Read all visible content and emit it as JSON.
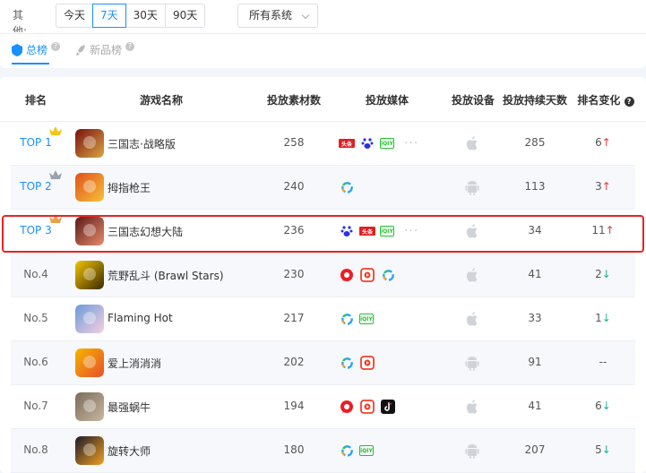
{
  "filters": {
    "other_label": "其他:",
    "date_buttons": [
      "今天",
      "7天",
      "30天",
      "90天"
    ],
    "active_date": "7天",
    "system_select": "所有系统"
  },
  "tabs": [
    {
      "label": "总榜",
      "active": true
    },
    {
      "label": "新品榜",
      "active": false
    }
  ],
  "table": {
    "headers": {
      "rank": "排名",
      "name": "游戏名称",
      "count": "投放素材数",
      "media": "投放媒体",
      "device": "投放设备",
      "days": "投放持续天数",
      "change": "排名变化"
    },
    "rows": [
      {
        "rank": "TOP 1",
        "name": "三国志·战略版",
        "count": "258",
        "media": [
          "toutiao-icon",
          "baidu-icon",
          "iqiyi-icon",
          "more-dots"
        ],
        "device": "apple-icon",
        "days": "285",
        "change": "6",
        "dir": "up"
      },
      {
        "rank": "TOP 2",
        "name": "拇指枪王",
        "count": "240",
        "media": [
          "ring-icon"
        ],
        "device": "android-icon",
        "days": "113",
        "change": "3",
        "dir": "up"
      },
      {
        "rank": "TOP 3",
        "name": "三国志幻想大陆",
        "count": "236",
        "media": [
          "baidu-icon",
          "toutiao-icon",
          "iqiyi-icon",
          "more-dots"
        ],
        "device": "apple-icon",
        "days": "34",
        "change": "11",
        "dir": "up"
      },
      {
        "rank": "No.4",
        "name": "荒野乱斗 (Brawl Stars)",
        "count": "230",
        "media": [
          "weibo-icon",
          "video-icon",
          "ring-icon"
        ],
        "device": "apple-icon",
        "days": "41",
        "change": "2",
        "dir": "down"
      },
      {
        "rank": "No.5",
        "name": "Flaming Hot",
        "count": "217",
        "media": [
          "ring-icon",
          "iqiyi-icon"
        ],
        "device": "apple-icon",
        "days": "33",
        "change": "1",
        "dir": "down"
      },
      {
        "rank": "No.6",
        "name": "爱上消消消",
        "count": "202",
        "media": [
          "ring-icon",
          "video-icon"
        ],
        "device": "android-icon",
        "days": "91",
        "change": "--",
        "dir": "none"
      },
      {
        "rank": "No.7",
        "name": "最强蜗牛",
        "count": "194",
        "media": [
          "weibo-icon",
          "video-icon",
          "tiktok-icon"
        ],
        "device": "apple-icon",
        "days": "41",
        "change": "6",
        "dir": "down"
      },
      {
        "rank": "No.8",
        "name": "旋转大师",
        "count": "180",
        "media": [
          "ring-icon",
          "iqiyi-icon"
        ],
        "device": "android-icon",
        "days": "207",
        "change": "5",
        "dir": "down"
      }
    ]
  },
  "colors": {
    "accent": "#1890ff",
    "up": "#ee3333",
    "down": "#1ab394",
    "highlight": "#e82424"
  }
}
